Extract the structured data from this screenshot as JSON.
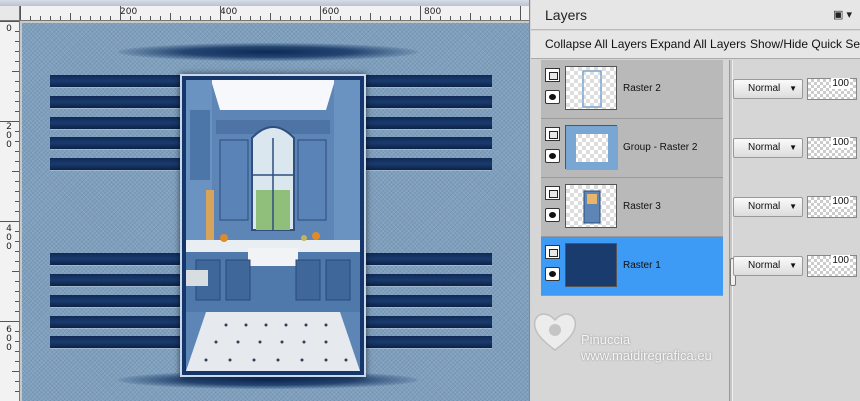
{
  "ruler": {
    "top_labels": [
      "200",
      "400",
      "600",
      "800"
    ],
    "left_labels": [
      "0",
      "2 0 0",
      "4 0 0",
      "6 0 0"
    ]
  },
  "layers_panel": {
    "title": "Layers",
    "menu_icons": "▣ ▾",
    "toolbar": {
      "collapse_label": "Collapse All Layers",
      "expand_label": "Expand All Layers",
      "quick_label": "Show/Hide Quick Sea"
    },
    "layers": [
      {
        "name": "Raster 2",
        "blend": "Normal",
        "opacity": "100",
        "selected": false,
        "thumb": "transparent"
      },
      {
        "name": "Group - Raster 2",
        "blend": "Normal",
        "opacity": "100",
        "selected": false,
        "thumb": "transparent"
      },
      {
        "name": "Raster 3",
        "blend": "Normal",
        "opacity": "100",
        "selected": false,
        "thumb": "transparent"
      },
      {
        "name": "Raster 1",
        "blend": "Normal",
        "opacity": "100",
        "selected": true,
        "thumb": "solid"
      }
    ]
  },
  "watermark": {
    "name": "Pinuccia",
    "url": "www.maidiregrafica.eu"
  },
  "colors": {
    "selected_row": "#3d9bf5",
    "navy_stripe": "#1a3b6e",
    "canvas_blue": "#7e9fbe"
  }
}
